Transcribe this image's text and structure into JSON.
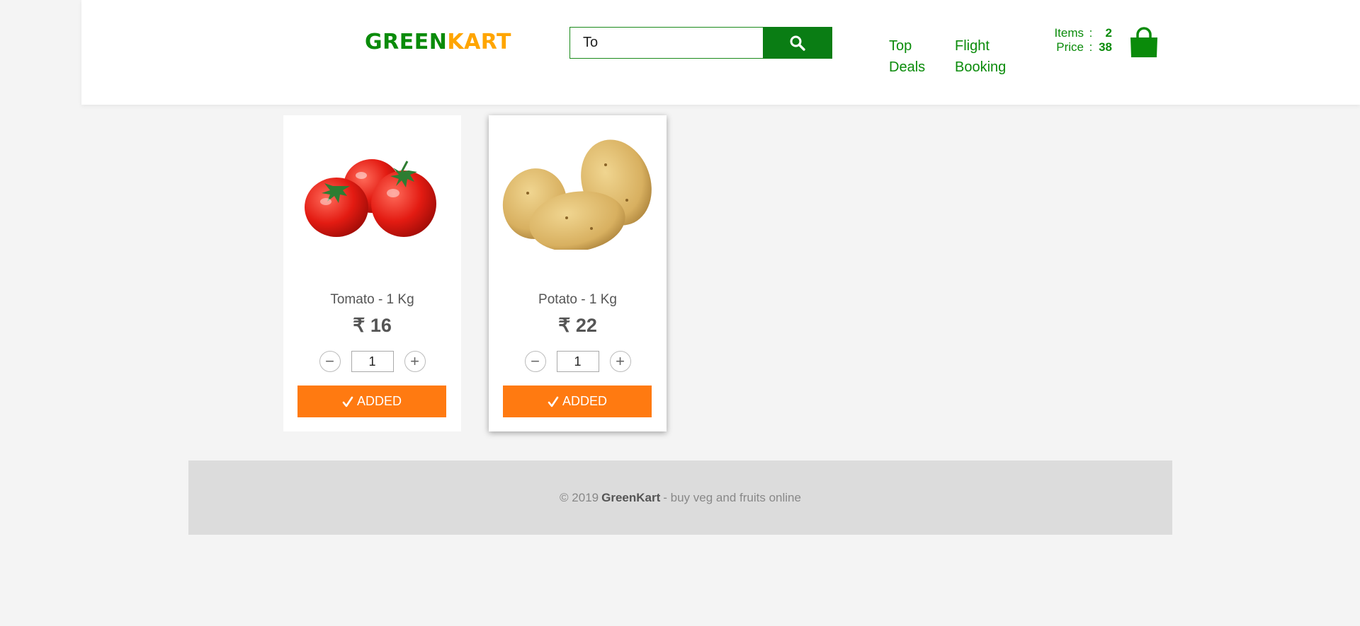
{
  "brand": {
    "part1": "GREEN",
    "part2": "KART"
  },
  "search": {
    "value": "To",
    "icon": "search-icon"
  },
  "nav": {
    "top_deals": [
      "Top",
      "Deals"
    ],
    "flight_booking": [
      "Flight",
      "Booking"
    ]
  },
  "cart": {
    "items_label": "Items",
    "items_value": "2",
    "price_label": "Price",
    "price_value": "38",
    "separator": ":",
    "icon": "shopping-bag-icon"
  },
  "products": [
    {
      "name": "Tomato - 1 Kg",
      "price": "₹ 16",
      "quantity": "1",
      "button_label": "ADDED",
      "button_icon": "check-icon",
      "minus": "−",
      "plus": "+"
    },
    {
      "name": "Potato - 1 Kg",
      "price": "₹ 22",
      "quantity": "1",
      "button_label": "ADDED",
      "button_icon": "check-icon",
      "minus": "−",
      "plus": "+"
    }
  ],
  "footer": {
    "prefix": "© 2019",
    "brand": "GreenKart",
    "suffix": "- buy veg and fruits online"
  },
  "colors": {
    "green": "#0a8b0a",
    "orange": "#ffa500",
    "button_orange": "#ff7a11",
    "search_green": "#0a7d14"
  }
}
